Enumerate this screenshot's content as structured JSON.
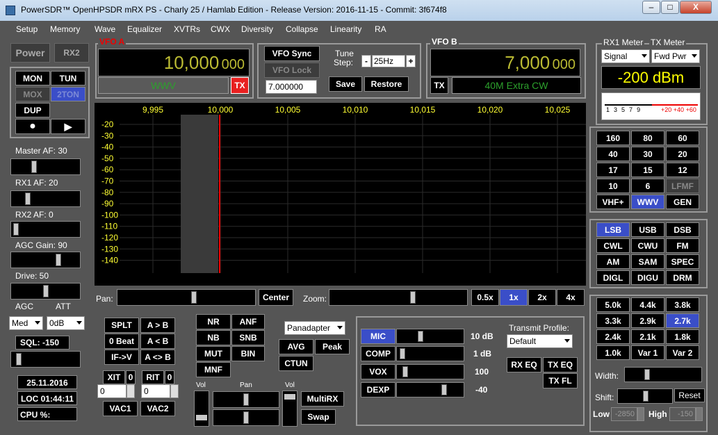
{
  "window": {
    "title": "PowerSDR™ OpenHPSDR mRX PS  -  Charly 25 / Hamlab Edition  -  Release Version: 2016-11-15  -  Commit: 3f674f8",
    "minimize": "–",
    "maximize": "□",
    "close": "X"
  },
  "menu": [
    "Setup",
    "Memory",
    "Wave",
    "Equalizer",
    "XVTRs",
    "CWX",
    "Diversity",
    "Collapse",
    "Linearity",
    "RA"
  ],
  "left": {
    "power": "Power",
    "rx2": "RX2",
    "mon": "MON",
    "tun": "TUN",
    "mox": "MOX",
    "2ton": "2TON",
    "dup": "DUP",
    "rec": "●",
    "play": "▶",
    "master_af": "Master AF:  30",
    "master_af_val": 0.3,
    "rx1_af": "RX1 AF:  20",
    "rx1_af_val": 0.2,
    "rx2_af": "RX2 AF:  0",
    "rx2_af_val": 0.0,
    "agc_gain": "AGC Gain:  90",
    "agc_gain_val": 0.72,
    "drive": "Drive:  50",
    "drive_val": 0.5,
    "agc": "AGC",
    "att": "ATT",
    "agc_sel": "Med",
    "att_sel": "0dB",
    "sql": "SQL:  -150",
    "sql_val": 0.05,
    "date": "25.11.2016",
    "loc": "LOC 01:44:11",
    "cpu": "CPU %:"
  },
  "vfoa": {
    "title": "VFO A",
    "freq_main": "10,000",
    "freq_sub": "000",
    "name": "WWV",
    "tx": "TX"
  },
  "vfomid": {
    "sync": "VFO Sync",
    "lock": "VFO Lock",
    "freq": "7.000000",
    "tune_label": "Tune",
    "step_label": "Step:",
    "minus": "-",
    "step": "25Hz",
    "plus": "+",
    "save": "Save",
    "restore": "Restore"
  },
  "vfob": {
    "title": "VFO B",
    "freq_main": "7,000",
    "freq_sub": "000",
    "tx": "TX",
    "name": "40M Extra CW"
  },
  "meter": {
    "rx_label": "RX1 Meter",
    "tx_label": "TX Meter",
    "rx_sel": "Signal",
    "tx_sel": "Fwd Pwr",
    "reading": "-200 dBm",
    "scale": [
      "1",
      "3",
      "5",
      "7",
      "9",
      "+20",
      "+40",
      "+60"
    ]
  },
  "pan": {
    "x_ticks": [
      "9,995",
      "10,000",
      "10,005",
      "10,010",
      "10,015",
      "10,020",
      "10,025"
    ],
    "y_ticks": [
      "-20",
      "-30",
      "-40",
      "-50",
      "-60",
      "-70",
      "-80",
      "-90",
      "-100",
      "-110",
      "-120",
      "-130",
      "-140"
    ],
    "pan_label": "Pan:",
    "center": "Center",
    "zoom_label": "Zoom:",
    "z05": "0.5x",
    "z1": "1x",
    "z2": "2x",
    "z4": "4x"
  },
  "bands": [
    "160",
    "80",
    "60",
    "40",
    "30",
    "20",
    "17",
    "15",
    "12",
    "10",
    "6",
    "LFMF",
    "VHF+",
    "WWV",
    "GEN"
  ],
  "modes": [
    "LSB",
    "USB",
    "DSB",
    "CWL",
    "CWU",
    "FM",
    "AM",
    "SAM",
    "SPEC",
    "DIGL",
    "DIGU",
    "DRM"
  ],
  "filters": [
    "5.0k",
    "4.4k",
    "3.8k",
    "3.3k",
    "2.9k",
    "2.7k",
    "2.4k",
    "2.1k",
    "1.8k",
    "1.0k",
    "Var 1",
    "Var 2"
  ],
  "filter_ctl": {
    "width": "Width:",
    "shift": "Shift:",
    "reset": "Reset",
    "low": "Low",
    "low_val": "-2850",
    "high": "High",
    "high_val": "-150"
  },
  "vfo_ops": {
    "splt": "SPLT",
    "a_to_b": "A > B",
    "zero_beat": "0 Beat",
    "a_from_b": "A < B",
    "if_v": "IF->V",
    "swap_ab": "A <> B",
    "xit": "XIT",
    "xit_val": "0",
    "xit_spin": "0",
    "rit": "RIT",
    "rit_val": "0",
    "rit_spin": "0",
    "vac1": "VAC1",
    "vac2": "VAC2"
  },
  "dsp": {
    "nr": "NR",
    "anf": "ANF",
    "nb": "NB",
    "snb": "SNB",
    "mut": "MUT",
    "bin": "BIN",
    "mnf": "MNF"
  },
  "display": {
    "mode": "Panadapter",
    "avg": "AVG",
    "peak": "Peak",
    "ctun": "CTUN"
  },
  "mix": {
    "vol": "Vol",
    "pan": "Pan",
    "vol2": "Vol",
    "multirx": "MultiRX",
    "swap": "Swap"
  },
  "tx": {
    "mic": "MIC",
    "mic_val": "10 dB",
    "comp": "COMP",
    "comp_val": "1 dB",
    "vox": "VOX",
    "vox_val": "100",
    "dexp": "DEXP",
    "dexp_val": "-40",
    "profile_label": "Transmit Profile:",
    "profile": "Default",
    "rxeq": "RX EQ",
    "txeq": "TX EQ",
    "txfl": "TX FL"
  }
}
